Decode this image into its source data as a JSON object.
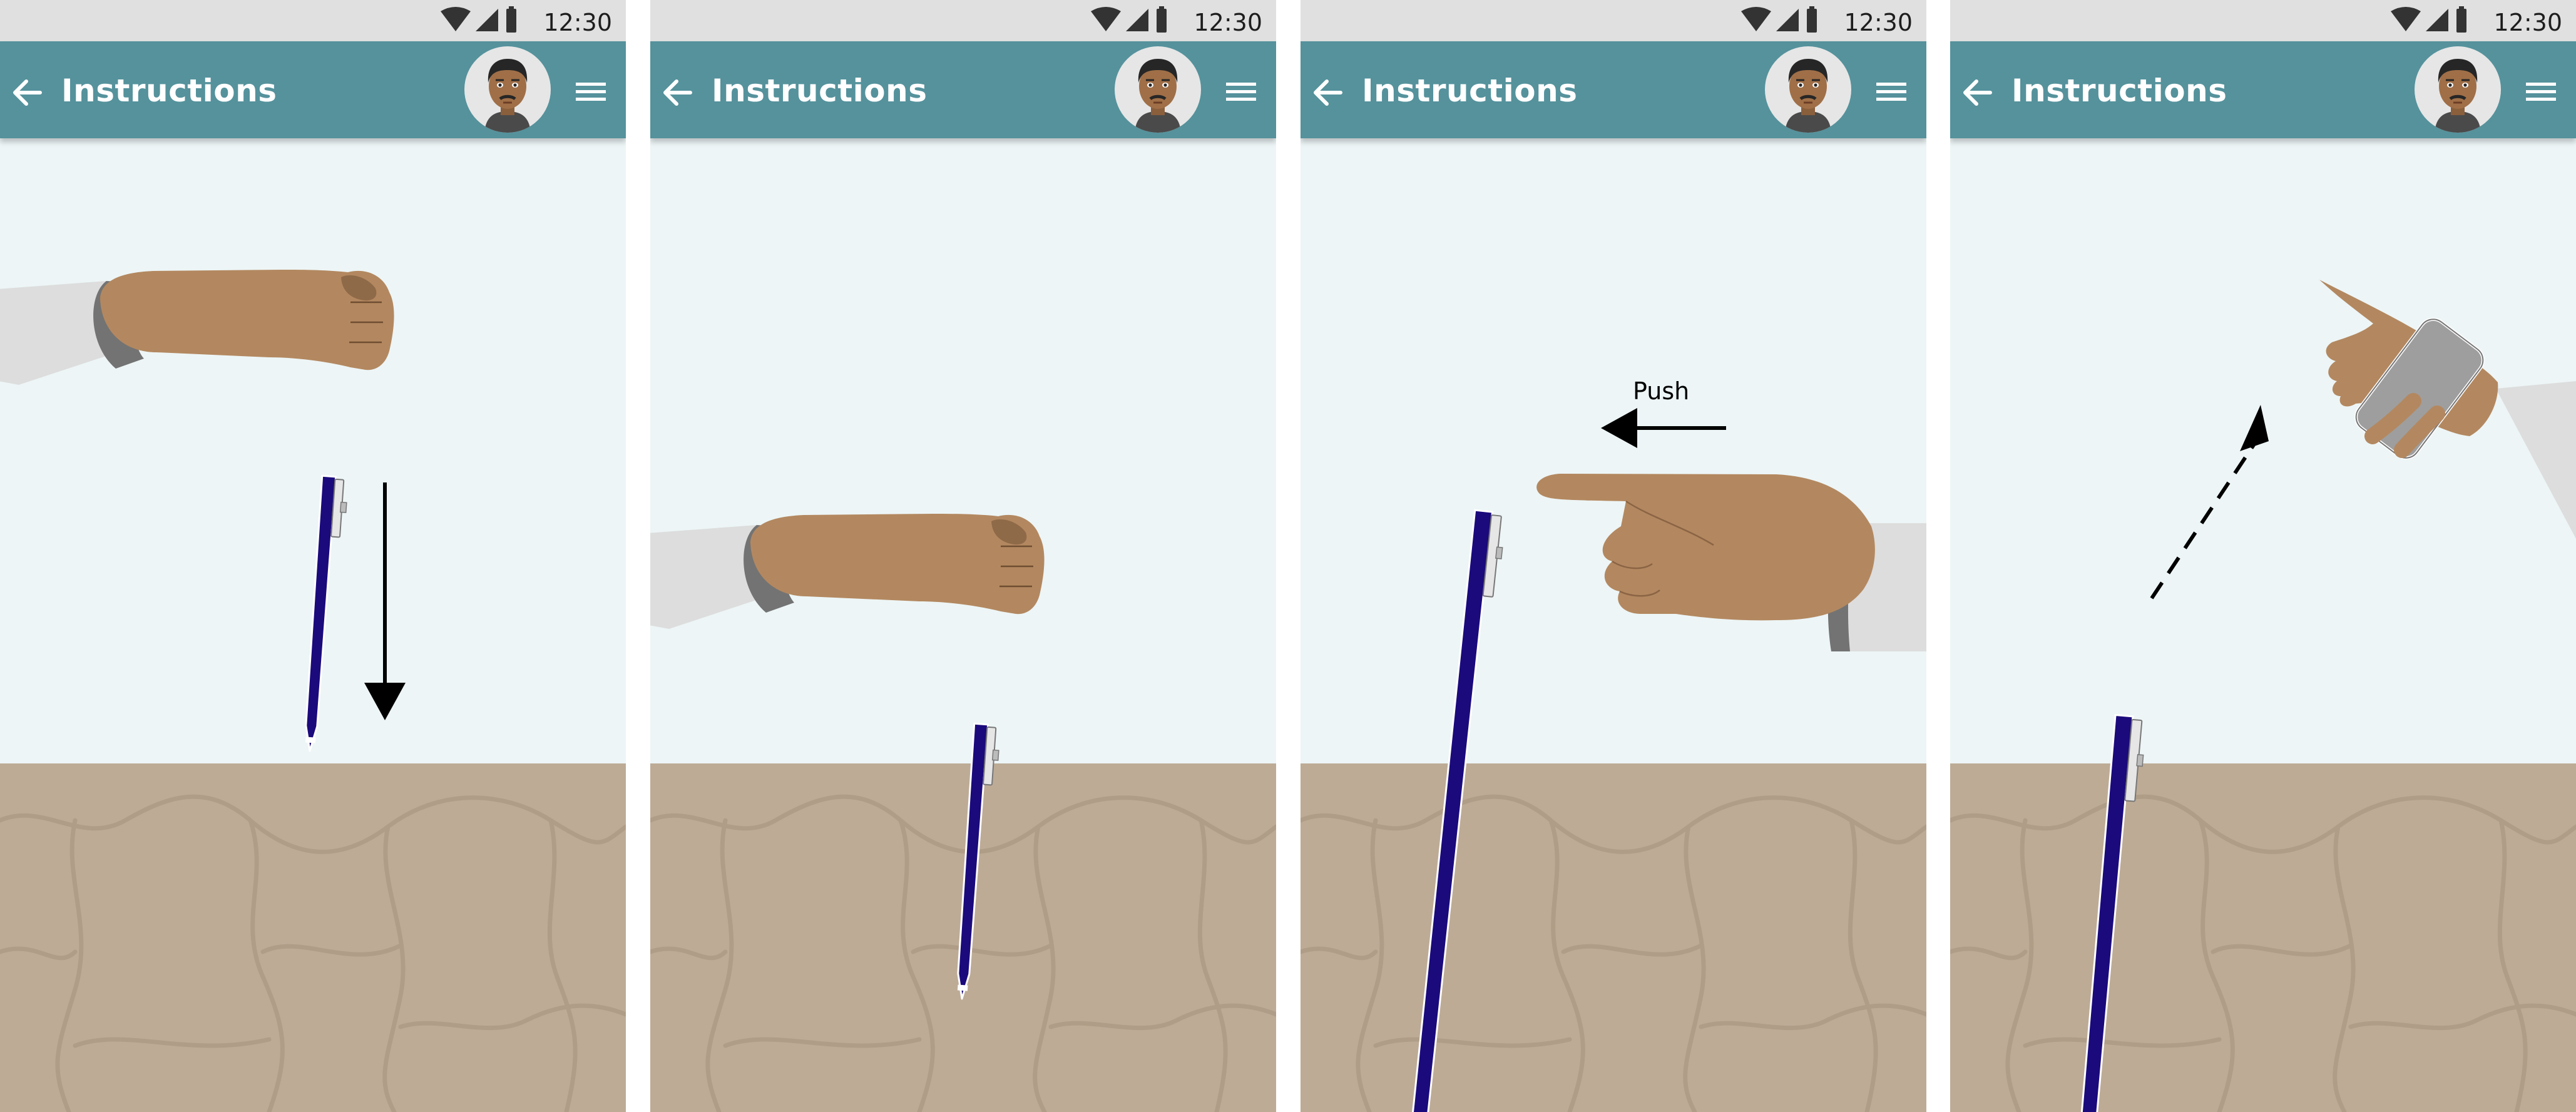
{
  "status_bar": {
    "time": "12:30"
  },
  "screens": [
    {
      "title": "Instructions"
    },
    {
      "title": "Instructions"
    },
    {
      "title": "Instructions"
    },
    {
      "title": "Instructions"
    }
  ],
  "step3_annotation": "Push",
  "icons": {
    "status": [
      "wifi-icon",
      "cell-signal-icon",
      "battery-icon"
    ],
    "app_bar": [
      "back-arrow-icon",
      "avatar",
      "hamburger-menu-icon"
    ]
  },
  "colors": {
    "status_bar": "#e0e0e0",
    "app_bar": "#55929c",
    "sky": "#edf5f6",
    "ground": "#bdab96",
    "pole": "#1a0a7c",
    "skin": "#b38860",
    "sleeve": "#dddddd",
    "phone": "#9e9e9e"
  }
}
